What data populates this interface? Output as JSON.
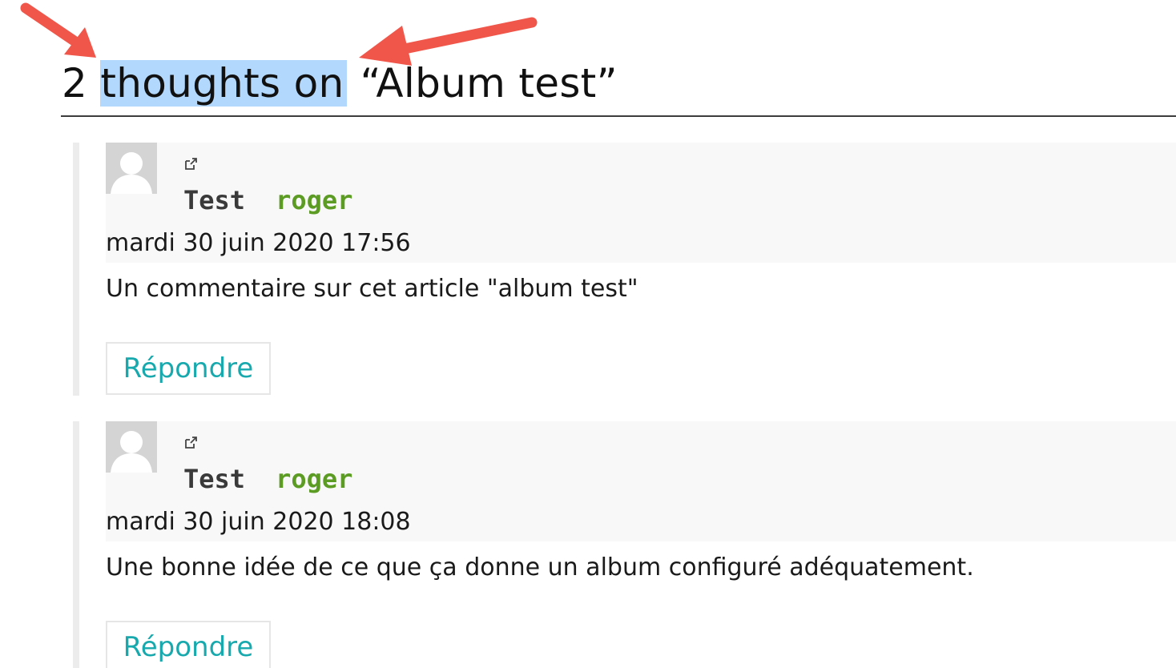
{
  "comments_section": {
    "title_count": "2",
    "title_highlighted": "thoughts on",
    "title_rest": "“Album test”"
  },
  "comments": [
    {
      "author": "Test",
      "username": "roger",
      "date": "mardi 30 juin 2020 17:56",
      "text": "Un commentaire sur cet article \"album test\"",
      "reply_label": "Répondre"
    },
    {
      "author": "Test",
      "username": "roger",
      "date": "mardi 30 juin 2020 18:08",
      "text": "Une bonne idée de ce que ça donne un album configuré adéquatement.",
      "reply_label": "Répondre"
    }
  ],
  "icons": {
    "external_link": "external-link-icon",
    "avatar": "default-avatar",
    "annotation_arrows": "red-arrow"
  },
  "colors": {
    "highlight": "#b3d8fd",
    "username": "#5c9c24",
    "reply_link": "#17a9ad",
    "arrow": "#f0564a"
  }
}
